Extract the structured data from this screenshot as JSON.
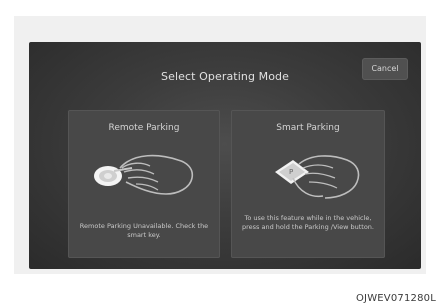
{
  "dialog": {
    "title": "Select Operating Mode",
    "cancel_label": "Cancel"
  },
  "cards": [
    {
      "title": "Remote Parking",
      "description": "Remote Parking Unavailable. Check the smart key.",
      "icon": "remote-key-hand-icon"
    },
    {
      "title": "Smart Parking",
      "description": "To use this feature while in the vehicle, press and hold the Parking /View button.",
      "icon": "parking-button-hand-icon"
    }
  ],
  "figure_code": "OJWEV071280L"
}
